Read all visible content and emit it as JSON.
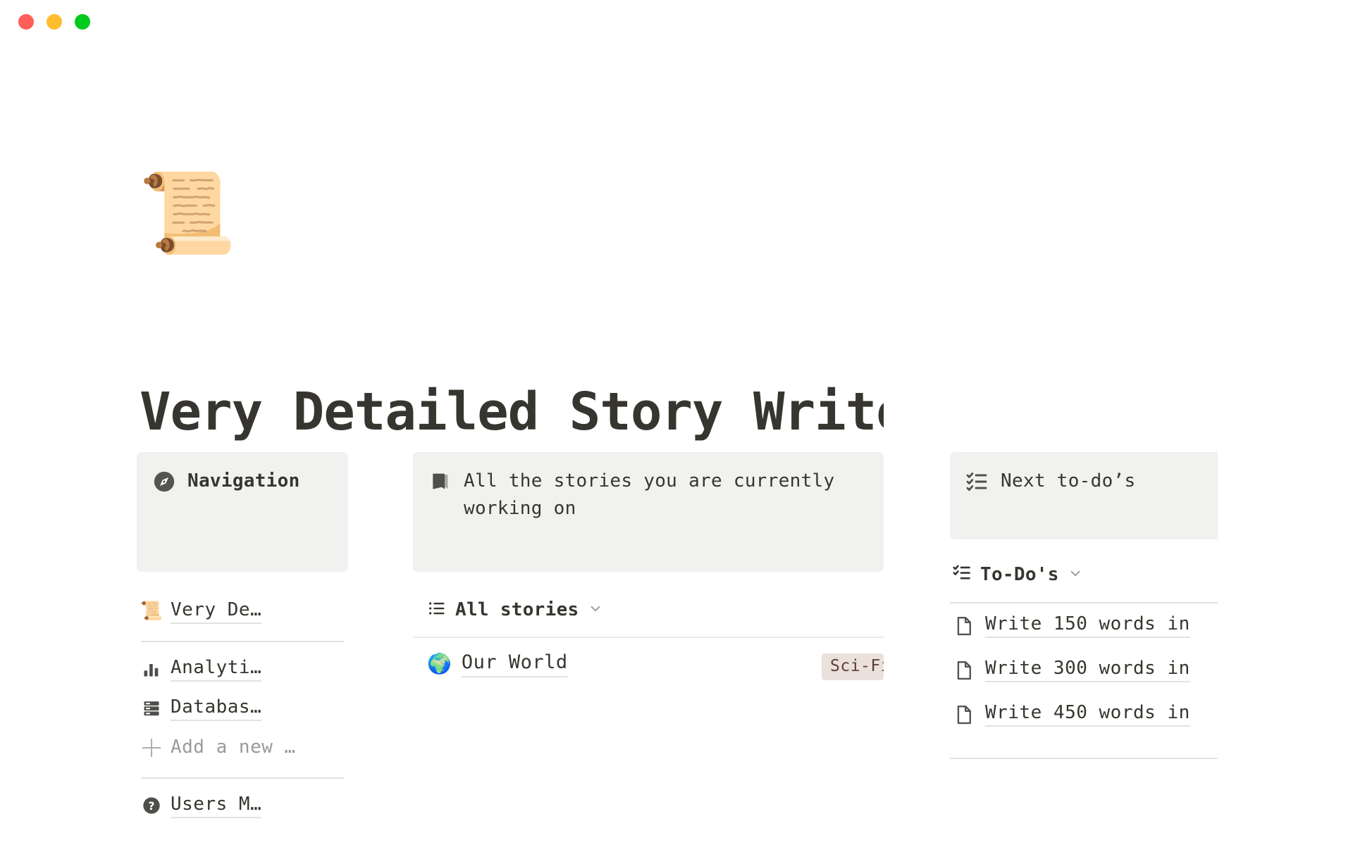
{
  "window": {
    "traffic_lights": [
      {
        "name": "close",
        "color": "#ff5f57"
      },
      {
        "name": "minimize",
        "color": "#ffbd2e"
      },
      {
        "name": "maximize",
        "color": "#00ca1f"
      }
    ]
  },
  "page": {
    "cover_icon": "📜",
    "title": "Very Detailed Story Writer"
  },
  "navigation": {
    "callout": {
      "icon": "compass-icon",
      "label": "Navigation"
    },
    "items": [
      {
        "icon": "📜",
        "icon_name": "scroll-emoji",
        "label": "Very De…",
        "underline": true
      },
      {
        "icon": "bar-chart-icon",
        "icon_name": "bar-chart-icon",
        "label": "Analyti…",
        "underline": true
      },
      {
        "icon": "database-icon",
        "icon_name": "database-icon",
        "label": "Databas…",
        "underline": true
      }
    ],
    "add_new": {
      "icon": "plus-icon",
      "label": "Add a new …"
    },
    "help": {
      "icon": "question-circle-icon",
      "label": "Users M…"
    }
  },
  "stories": {
    "callout": {
      "icon": "book-icon",
      "label": "All the stories you are currently working on"
    },
    "view": {
      "icon": "list-icon",
      "label": "All stories",
      "chevron": "chevron-down-icon"
    },
    "rows": [
      {
        "emoji": "🌍",
        "name": "Our World",
        "tag": "Sci-Fi",
        "tag_bg": "#eae0dc",
        "tag_color": "#5c4033"
      }
    ]
  },
  "todos": {
    "callout": {
      "icon": "checklist-icon",
      "label": "Next to-do’s"
    },
    "view": {
      "icon": "checklist-icon",
      "label": "To-Do's",
      "chevron": "chevron-down-icon"
    },
    "items": [
      {
        "icon": "page-icon",
        "label": "Write 150 words in"
      },
      {
        "icon": "page-icon",
        "label": "Write 300 words in"
      },
      {
        "icon": "page-icon",
        "label": "Write 450 words in"
      }
    ]
  },
  "colors": {
    "callout_bg": "#f1f1ef",
    "text": "#37352f",
    "muted": "#9b9a97",
    "divider": "#e3e2e0",
    "tag_bg": "#eae0dc"
  }
}
